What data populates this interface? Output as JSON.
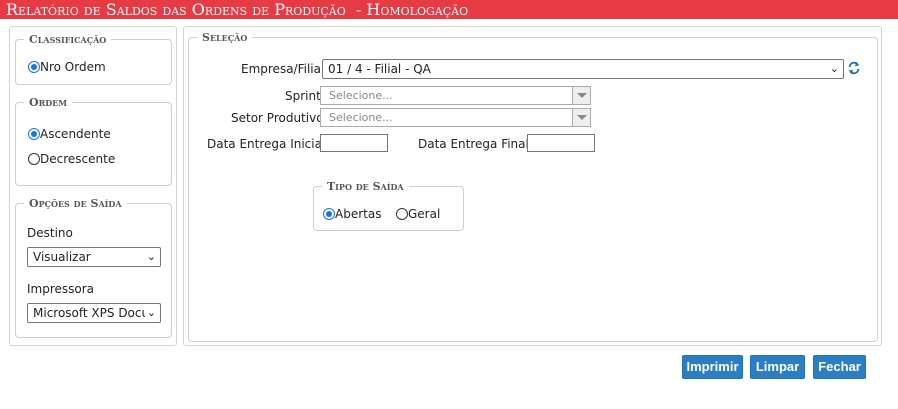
{
  "window": {
    "title": "Relatório de Saldos das Ordens de Produção  - Homologação"
  },
  "classificacao": {
    "legend": "Classificação",
    "options": [
      {
        "label": "Nro Ordem",
        "checked": true
      }
    ]
  },
  "ordem": {
    "legend": "Ordem",
    "options": [
      {
        "label": "Ascendente",
        "checked": true
      },
      {
        "label": "Decrescente",
        "checked": false
      }
    ]
  },
  "opcoes_saida": {
    "legend": "Opções de Saída",
    "destino_label": "Destino",
    "destino_value": "Visualizar",
    "impressora_label": "Impressora",
    "impressora_value": "Microsoft XPS Docur"
  },
  "selecao": {
    "legend": "Seleção",
    "empresa_label": "Empresa/Filial:",
    "empresa_value": "01 / 4 - Filial - QA",
    "sprint_label": "Sprint:",
    "sprint_placeholder": "Selecione...",
    "setor_label": "Setor Produtivo:",
    "setor_placeholder": "Selecione...",
    "data_inicial_label": "Data Entrega Inicial:",
    "data_inicial_value": "",
    "data_final_label": "Data Entrega Final:",
    "data_final_value": ""
  },
  "tipo_saida": {
    "legend": "Tipo de Saída",
    "options": [
      {
        "label": "Abertas",
        "checked": true
      },
      {
        "label": "Geral",
        "checked": false
      }
    ]
  },
  "buttons": {
    "imprimir": "Imprimir",
    "limpar": "Limpar",
    "fechar": "Fechar"
  },
  "icons": {
    "refresh": "refresh-icon",
    "chevron": "chevron-down-icon"
  },
  "colors": {
    "title_bar": "#e63b45",
    "button": "#2b7ec1",
    "radio_selected": "#1a73e8"
  }
}
